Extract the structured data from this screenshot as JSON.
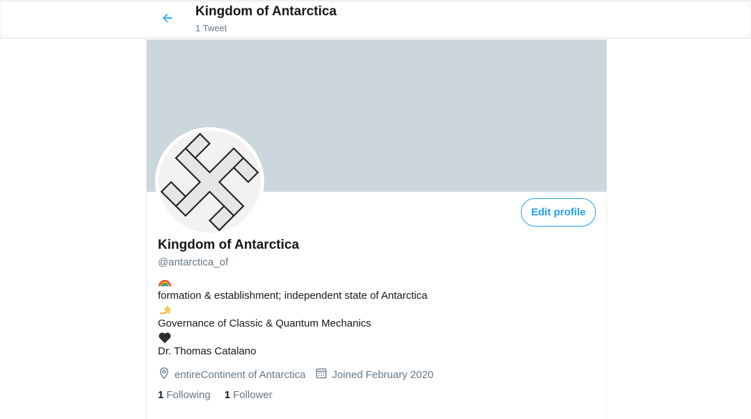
{
  "header": {
    "title": "Kingdom of Antarctica",
    "tweet_count": "1 Tweet",
    "back_icon": "arrow-left-icon",
    "accent_color": "#1da1f2"
  },
  "profile": {
    "banner_color": "#ccd6dd",
    "avatar_icon": "emblem-icon",
    "edit_label": "Edit profile",
    "name": "Kingdom of Antarctica",
    "handle": "@antarctica_of",
    "bio": {
      "emoji1": "rainbow-emoji",
      "line1": "formation & establishment; independent state of Antarctica",
      "emoji2": "dizzy-emoji",
      "line2": "Governance of Classic & Quantum Mechanics",
      "emoji3": "black-heart-emoji",
      "line3": "Dr. Thomas Catalano"
    },
    "location": "entireContinent of Antarctica",
    "joined": "Joined February 2020",
    "following_count": "1",
    "following_label": "Following",
    "followers_count": "1",
    "followers_label": "Follower"
  }
}
